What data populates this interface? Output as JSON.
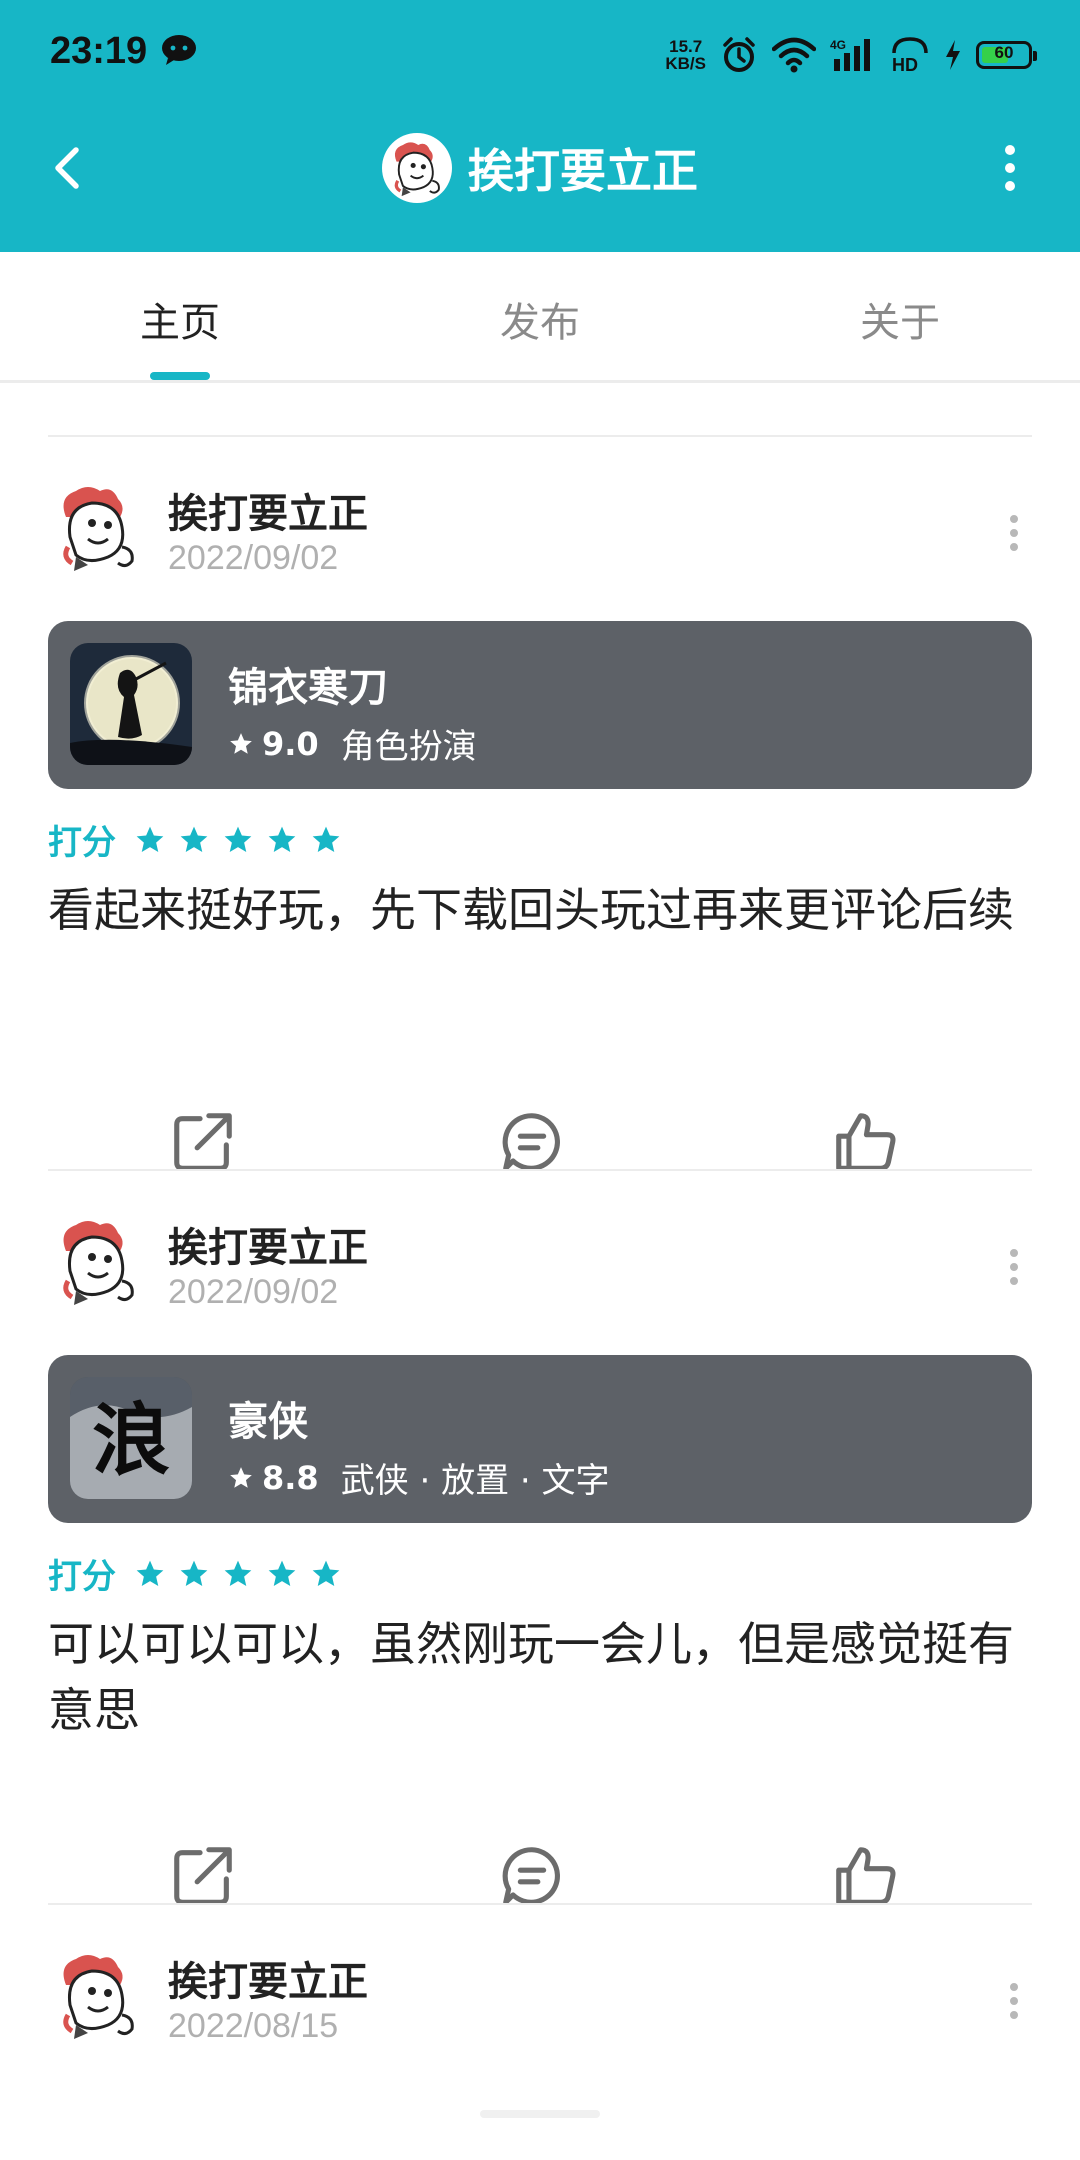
{
  "status_bar": {
    "time": "23:19",
    "net_speed_value": "15.7",
    "net_speed_unit": "KB/S",
    "battery_level": "60",
    "battery_fraction": 0.6,
    "icons": [
      "wechat-icon",
      "alarm-icon",
      "wifi-icon",
      "4g-signal-icon",
      "hd-icon",
      "charging-icon",
      "battery-icon"
    ]
  },
  "header": {
    "title": "挨打要立正",
    "color": "#17b6c6"
  },
  "tabs": [
    {
      "label": "主页",
      "active": true
    },
    {
      "label": "发布",
      "active": false
    },
    {
      "label": "关于",
      "active": false
    }
  ],
  "posts": [
    {
      "user": "挨打要立正",
      "date": "2022/09/02",
      "game": {
        "name": "锦衣寒刀",
        "score": "9.0",
        "tags": "角色扮演"
      },
      "rating_label": "打分",
      "stars": 5,
      "text": "看起来挺好玩，先下载回头玩过再来更评论后续"
    },
    {
      "user": "挨打要立正",
      "date": "2022/09/02",
      "game": {
        "name": "豪侠",
        "score": "8.8",
        "tags": "武侠 · 放置 · 文字"
      },
      "rating_label": "打分",
      "stars": 5,
      "text": "可以可以可以，虽然刚玩一会儿，但是感觉挺有意思"
    },
    {
      "user": "挨打要立正",
      "date": "2022/08/15"
    }
  ]
}
